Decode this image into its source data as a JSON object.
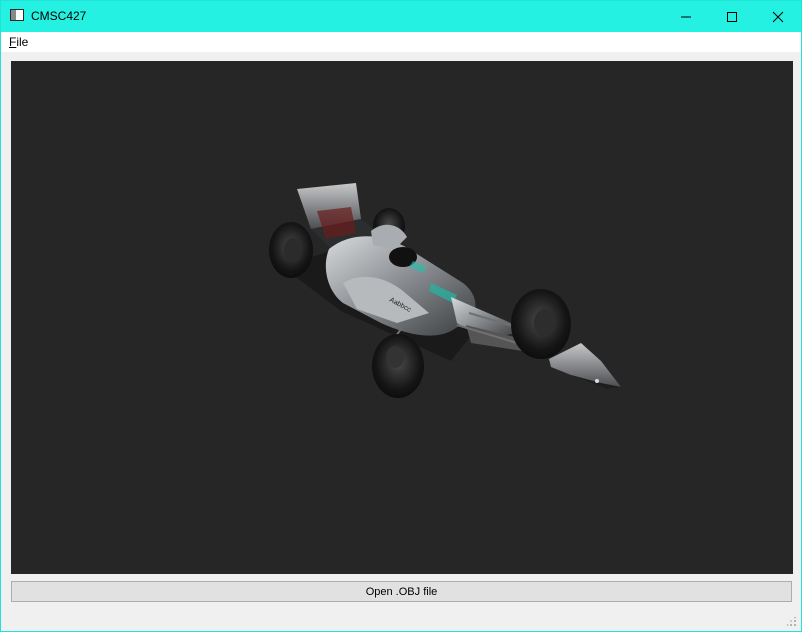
{
  "window": {
    "title": "CMSC427",
    "icons": {
      "app": "app-window-icon",
      "minimize": "minimize-icon",
      "maximize": "maximize-icon",
      "close": "close-icon"
    }
  },
  "menubar": {
    "file_accel": "F",
    "file_rest": "ile"
  },
  "viewport": {
    "background": "#262626",
    "model": "formula-one-car-render"
  },
  "open_button": {
    "label": "Open .OBJ file"
  },
  "colors": {
    "titlebar": "#24f1e2",
    "viewport": "#262626"
  }
}
